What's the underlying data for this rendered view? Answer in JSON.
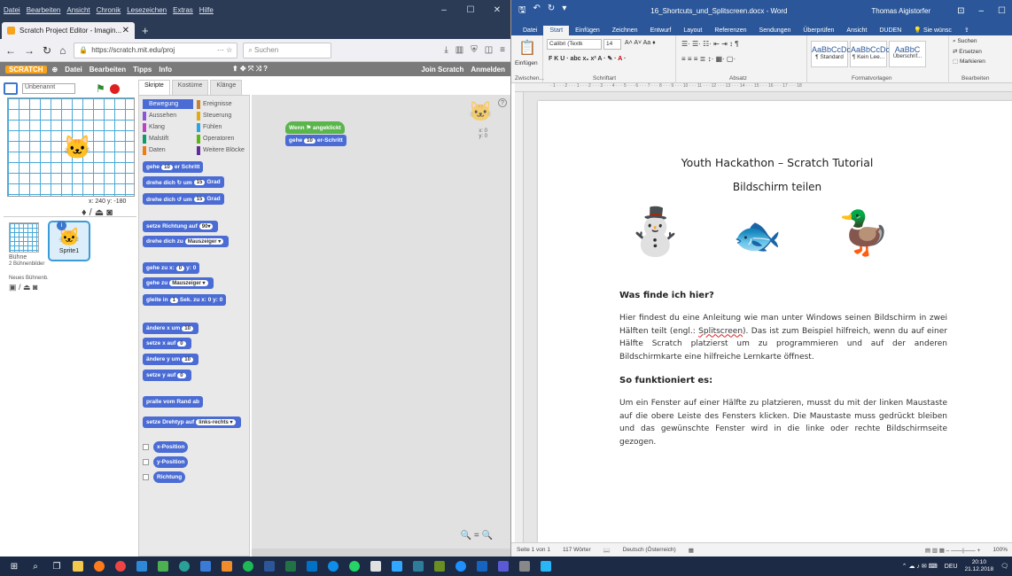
{
  "firefox": {
    "menu": [
      "Datei",
      "Bearbeiten",
      "Ansicht",
      "Chronik",
      "Lesezeichen",
      "Extras",
      "Hilfe"
    ],
    "tab_title": "Scratch Project Editor - Imagin...",
    "url": "https://scratch.mit.edu/proj",
    "search_placeholder": "Suchen"
  },
  "scratch": {
    "menu": [
      "Datei",
      "Bearbeiten",
      "Tipps",
      "Info"
    ],
    "logo": "SCRATCH",
    "join": "Join Scratch",
    "signin": "Anmelden",
    "sprite_name": "Unbenannt",
    "mouse_xy": "x: 240  y: -180",
    "tabs": [
      "Skripte",
      "Kostüme",
      "Klänge"
    ],
    "categories": [
      {
        "name": "Bewegung",
        "color": "#4a6cd4"
      },
      {
        "name": "Ereignisse",
        "color": "#c88330"
      },
      {
        "name": "Aussehen",
        "color": "#8a55d7"
      },
      {
        "name": "Steuerung",
        "color": "#e1a91a"
      },
      {
        "name": "Klang",
        "color": "#bb42c3"
      },
      {
        "name": "Fühlen",
        "color": "#2ca5e2"
      },
      {
        "name": "Malstift",
        "color": "#0e9a6c"
      },
      {
        "name": "Operatoren",
        "color": "#5cb712"
      },
      {
        "name": "Daten",
        "color": "#ee7d16"
      },
      {
        "name": "Weitere Blöcke",
        "color": "#632d99"
      }
    ],
    "blocks": [
      {
        "pre": "gehe",
        "val": "10",
        "post": "er Schritt"
      },
      {
        "pre": "drehe dich ↻ um",
        "val": "15",
        "post": "Grad"
      },
      {
        "pre": "drehe dich ↺ um",
        "val": "15",
        "post": "Grad"
      },
      {
        "pre": "setze Richtung auf",
        "val": "90▾",
        "post": ""
      },
      {
        "pre": "drehe dich zu",
        "val": "Mauszeiger ▾",
        "post": ""
      },
      {
        "pre": "gehe zu x:",
        "val": "0",
        "post": "y: 0"
      },
      {
        "pre": "gehe zu",
        "val": "Mauszeiger ▾",
        "post": ""
      },
      {
        "pre": "gleite in",
        "val": "1",
        "post": "Sek. zu x: 0 y: 0"
      },
      {
        "pre": "ändere x um",
        "val": "10",
        "post": ""
      },
      {
        "pre": "setze x auf",
        "val": "0",
        "post": ""
      },
      {
        "pre": "ändere y um",
        "val": "10",
        "post": ""
      },
      {
        "pre": "setze y auf",
        "val": "0",
        "post": ""
      },
      {
        "pre": "pralle vom Rand ab",
        "val": "",
        "post": ""
      },
      {
        "pre": "setze Drehtyp auf",
        "val": "links-rechts ▾",
        "post": ""
      }
    ],
    "reporters": [
      "x-Position",
      "y-Position",
      "Richtung"
    ],
    "script_hat": "Wenn ⚑ angeklickt",
    "script_block": {
      "pre": "gehe",
      "val": "10",
      "post": "er-Schritt"
    },
    "stage_label": "Bühne",
    "stage_sub": "2 Bühnenbilder",
    "new_backdrop": "Neues Bühnenb.",
    "sprite_label": "Sprite1",
    "ghost_xy": "x: 0\ny: 0"
  },
  "word": {
    "doc_title": "16_Shortcuts_und_Splitscreen.docx - Word",
    "user": "Thomas Aigistorfer",
    "tabs": [
      "Datei",
      "Start",
      "Einfügen",
      "Zeichnen",
      "Entwurf",
      "Layout",
      "Referenzen",
      "Sendungen",
      "Überprüfen",
      "Ansicht",
      "DUDEN"
    ],
    "tell_me": "Sie wünsc",
    "font_name": "Calibri (Textk",
    "font_size": "14",
    "groups": [
      "Zwischen...",
      "Schriftart",
      "Absatz",
      "Formatvorlagen",
      "Bearbeiten"
    ],
    "styles": [
      {
        "sample": "AaBbCcDc",
        "name": "¶ Standard"
      },
      {
        "sample": "AaBbCcDc",
        "name": "¶ Kein Lee..."
      },
      {
        "sample": "AaBbC",
        "name": "Überschrif..."
      }
    ],
    "edit_items": [
      "Suchen",
      "Ersetzen",
      "Markieren"
    ],
    "paste": "Einfügen",
    "content": {
      "title": "Youth Hackathon – Scratch Tutorial",
      "subtitle": "Bildschirm teilen",
      "h1": "Was finde ich hier?",
      "p1_a": "Hier findest du eine Anleitung wie man unter Windows seinen Bildschirm in zwei Hälften teilt (engl.: ",
      "p1_link": "Splitscreen",
      "p1_b": "). Das ist zum Beispiel hilfreich, wenn du auf einer Hälfte Scratch platzierst um zu programmieren und auf der anderen Bildschirmkarte eine hilfreiche Lernkarte öffnest.",
      "h2": "So funktioniert es:",
      "p2": "Um ein Fenster auf einer Hälfte zu platzieren, musst du mit der linken Maustaste auf die obere Leiste des Fensters klicken. Die Maustaste muss gedrückt bleiben und das gewünschte Fenster wird in die linke oder rechte Bildschirmseite gezogen."
    },
    "status": {
      "page": "Seite 1 von 1",
      "words": "117 Wörter",
      "lang": "Deutsch (Österreich)",
      "zoom": "100%"
    }
  },
  "taskbar": {
    "time": "20:10",
    "date": "21.12.2018",
    "lang": "DEU"
  }
}
